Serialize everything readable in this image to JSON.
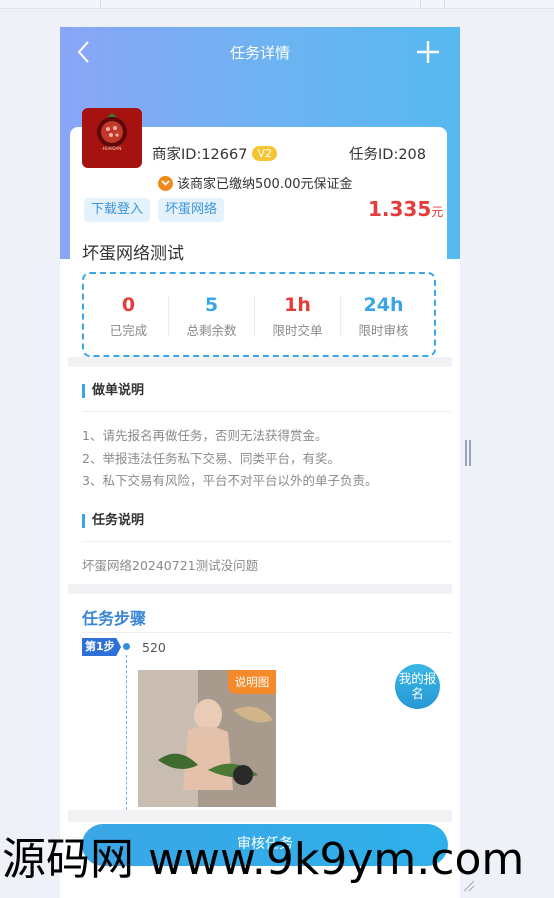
{
  "header": {
    "title": "任务详情"
  },
  "merchant": {
    "id_label": "商家ID:12667",
    "level": "V2",
    "task_id_label": "任务ID:208",
    "deposit_text": "该商家已缴纳500.00元保证金",
    "logo_text": "·HUAIDAN·"
  },
  "tags": [
    "下载登入",
    "坏蛋网络"
  ],
  "price": {
    "amount": "1.335",
    "unit": "元"
  },
  "task": {
    "title": "坏蛋网络测试"
  },
  "stats": [
    {
      "value": "0",
      "label": "已完成",
      "color": "#e63b3b"
    },
    {
      "value": "5",
      "label": "总剩余数",
      "color": "#3aa6e6"
    },
    {
      "value": "1h",
      "label": "限时交单",
      "color": "#e63b3b"
    },
    {
      "value": "24h",
      "label": "限时审核",
      "color": "#3aa6e6"
    }
  ],
  "rules": {
    "heading": "做单说明",
    "lines": [
      "1、请先报名再做任务，否则无法获得赏金。",
      "2、举报违法任务私下交易、同类平台，有奖。",
      "3、私下交易有风险，平台不对平台以外的单子负责。"
    ]
  },
  "description": {
    "heading": "任务说明",
    "text": "坏蛋网络20240721测试没问题"
  },
  "steps": {
    "heading": "任务步骤",
    "items": [
      {
        "badge": "第1步",
        "text": "520",
        "image_tag": "说明图"
      }
    ]
  },
  "actions": {
    "my_signup": "我的报名",
    "review": "审核任务"
  },
  "watermark": "源码网 www.9k9ym.com",
  "colors": {
    "accent": "#3aa6e6",
    "price": "#e63b3b",
    "tag_bg": "#e4f2fc"
  }
}
